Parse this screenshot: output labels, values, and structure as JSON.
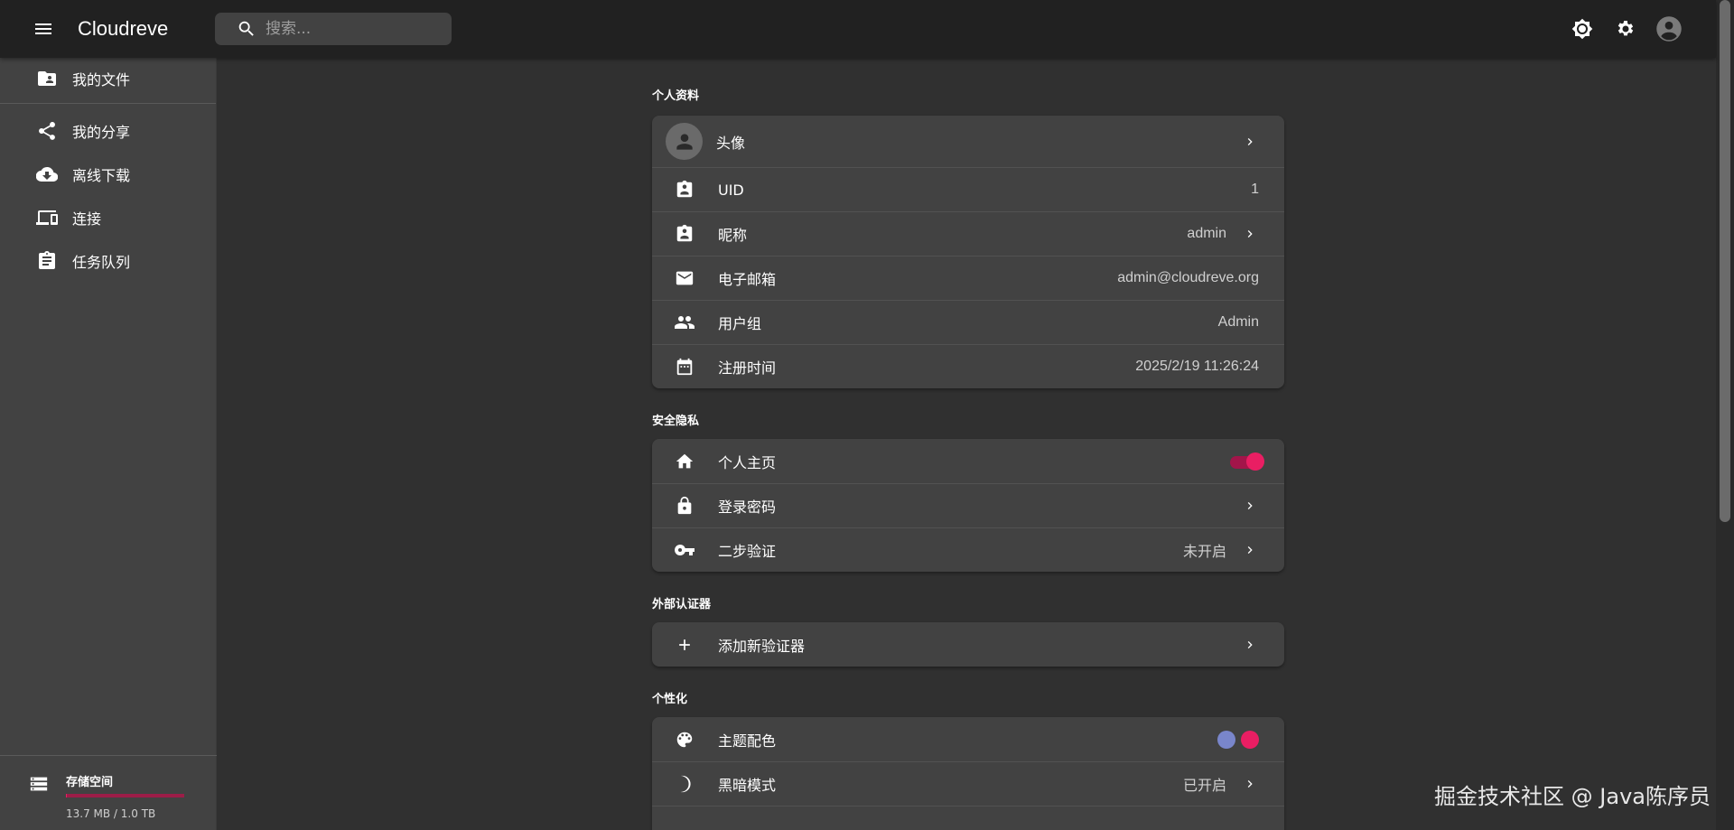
{
  "app": {
    "title": "Cloudreve"
  },
  "search": {
    "placeholder": "搜索..."
  },
  "sidebar": {
    "items": [
      {
        "label": "我的文件",
        "icon": "folder-account-icon"
      },
      {
        "label": "我的分享",
        "icon": "share-icon"
      },
      {
        "label": "离线下载",
        "icon": "cloud-download-icon"
      },
      {
        "label": "连接",
        "icon": "devices-icon"
      },
      {
        "label": "任务队列",
        "icon": "clipboard-list-icon"
      }
    ],
    "storage": {
      "label": "存储空间",
      "usage": "13.7 MB / 1.0 TB",
      "used_fraction": 1.28e-05
    }
  },
  "sections": {
    "profile": {
      "title": "个人资料",
      "avatar_label": "头像",
      "uid_label": "UID",
      "uid_value": "1",
      "nickname_label": "昵称",
      "nickname_value": "admin",
      "email_label": "电子邮箱",
      "email_value": "admin@cloudreve.org",
      "group_label": "用户组",
      "group_value": "Admin",
      "registered_label": "注册时间",
      "registered_value": "2025/2/19 11:26:24"
    },
    "security": {
      "title": "安全隐私",
      "homepage_label": "个人主页",
      "homepage_enabled": true,
      "password_label": "登录密码",
      "twofa_label": "二步验证",
      "twofa_value": "未开启"
    },
    "authenticators": {
      "title": "外部认证器",
      "add_label": "添加新验证器"
    },
    "personalization": {
      "title": "个性化",
      "theme_label": "主题配色",
      "theme_colors": [
        "#7986cb",
        "#e91e63"
      ],
      "dark_label": "黑暗模式",
      "dark_value": "已开启"
    }
  },
  "watermark": "掘金技术社区 @ Java陈序员",
  "colors": {
    "accent": "#e91e63",
    "appbar": "#212121",
    "surface": "#424242",
    "background": "#303030"
  }
}
